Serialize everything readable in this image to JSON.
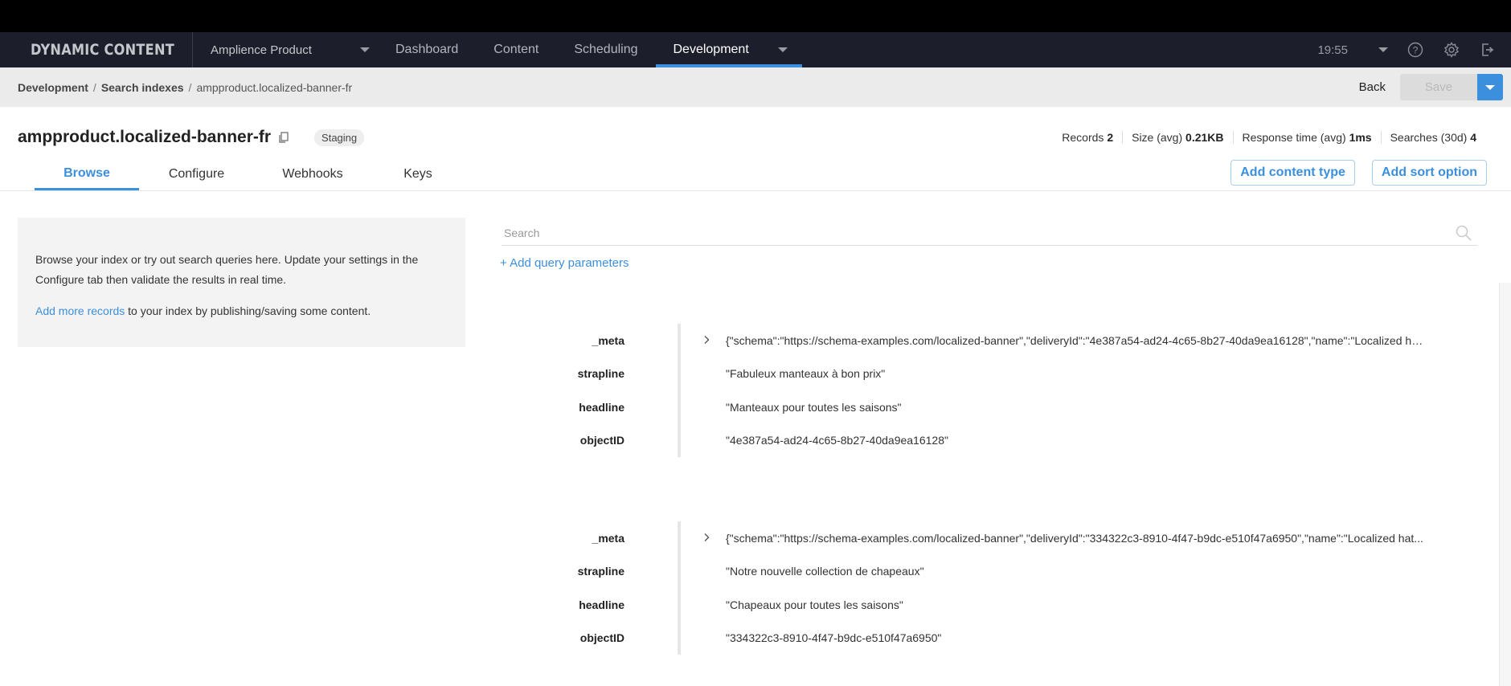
{
  "app": {
    "brand": "DYNAMIC CONTENT",
    "hub": "Amplience Product",
    "nav": [
      "Dashboard",
      "Content",
      "Scheduling",
      "Development"
    ],
    "active_nav": "Development",
    "time": "19:55",
    "icons": [
      "help-icon",
      "settings-icon",
      "logout-icon"
    ]
  },
  "breadcrumb": {
    "items": [
      "Development",
      "Search indexes",
      "ampproduct.localized-banner-fr"
    ],
    "back_label": "Back",
    "save_label": "Save"
  },
  "header": {
    "title": "ampproduct.localized-banner-fr",
    "badge": "Staging",
    "stats": [
      {
        "label": "Records",
        "value": "2"
      },
      {
        "label": "Size (avg)",
        "value": "0.21KB"
      },
      {
        "label": "Response time (avg)",
        "value": "1ms"
      },
      {
        "label": "Searches (30d)",
        "value": "4"
      }
    ],
    "tabs": [
      "Browse",
      "Configure",
      "Webhooks",
      "Keys"
    ],
    "active_tab": "Browse",
    "actions": [
      "Add content type",
      "Add sort option"
    ]
  },
  "info": {
    "text1": "Browse your index or try out search queries here. Update your settings in the Configure tab then validate the results in real time.",
    "link": "Add more records",
    "text2": " to your index by publishing/saving some content."
  },
  "search": {
    "placeholder": "Search",
    "value": "",
    "add_query": "+ Add query parameters"
  },
  "records": [
    {
      "fields": [
        {
          "key": "_meta",
          "value": "{\"schema\":\"https://schema-examples.com/localized-banner\",\"deliveryId\":\"4e387a54-ad24-4c65-8b27-40da9ea16128\",\"name\":\"Localized ha...",
          "expandable": true
        },
        {
          "key": "strapline",
          "value": "\"Fabuleux manteaux à bon prix\""
        },
        {
          "key": "headline",
          "value": "\"Manteaux pour toutes les saisons\""
        },
        {
          "key": "objectID",
          "value": "\"4e387a54-ad24-4c65-8b27-40da9ea16128\""
        }
      ]
    },
    {
      "fields": [
        {
          "key": "_meta",
          "value": "{\"schema\":\"https://schema-examples.com/localized-banner\",\"deliveryId\":\"334322c3-8910-4f47-b9dc-e510f47a6950\",\"name\":\"Localized hat...",
          "expandable": true
        },
        {
          "key": "strapline",
          "value": "\"Notre nouvelle collection de chapeaux\""
        },
        {
          "key": "headline",
          "value": "\"Chapeaux pour toutes les saisons\""
        },
        {
          "key": "objectID",
          "value": "\"334322c3-8910-4f47-b9dc-e510f47a6950\""
        }
      ]
    }
  ],
  "colors": {
    "accent": "#3c8fdd",
    "navbar": "#1c1f2b",
    "breadcrumb_bg": "#ebebeb"
  }
}
